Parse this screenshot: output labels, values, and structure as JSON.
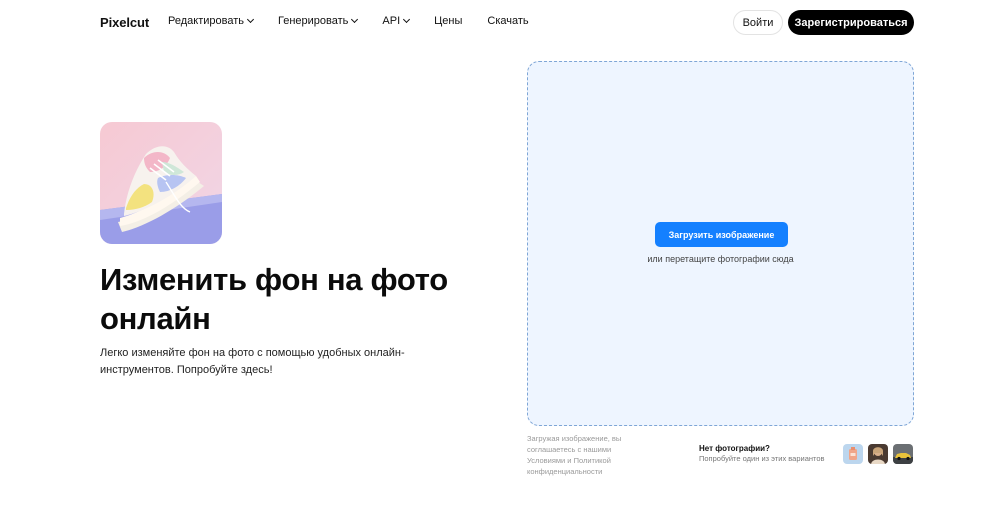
{
  "header": {
    "logo": "Pixelcut",
    "nav": [
      {
        "label": "Редактировать",
        "dropdown": true
      },
      {
        "label": "Генерировать",
        "dropdown": true
      },
      {
        "label": "API",
        "dropdown": true
      },
      {
        "label": "Цены",
        "dropdown": false
      },
      {
        "label": "Скачать",
        "dropdown": false
      }
    ],
    "login_label": "Войти",
    "signup_label": "Зарегистрироваться"
  },
  "hero": {
    "image_icon": "sneaker-photo",
    "title": "Изменить фон на фото онлайн",
    "subtitle": "Легко изменяйте фон на фото с помощью удобных онлайн-инструментов. Попробуйте здесь!"
  },
  "upload": {
    "button_label": "Загрузить изображение",
    "drop_hint": "или перетащите фотографии сюда",
    "terms": "Загружая изображение, вы соглашаетесь с нашими Условиями и Политикой конфиденциальности",
    "no_photo_title": "Нет фотографии?",
    "no_photo_sub": "Попробуйте один из этих вариантов",
    "samples": [
      {
        "icon": "product-sample"
      },
      {
        "icon": "person-sample"
      },
      {
        "icon": "car-sample"
      }
    ]
  },
  "colors": {
    "accent": "#1480ff",
    "dropzone_bg": "#eef5ff",
    "dropzone_border": "#7fa6d6",
    "signup_bg": "#000000"
  }
}
